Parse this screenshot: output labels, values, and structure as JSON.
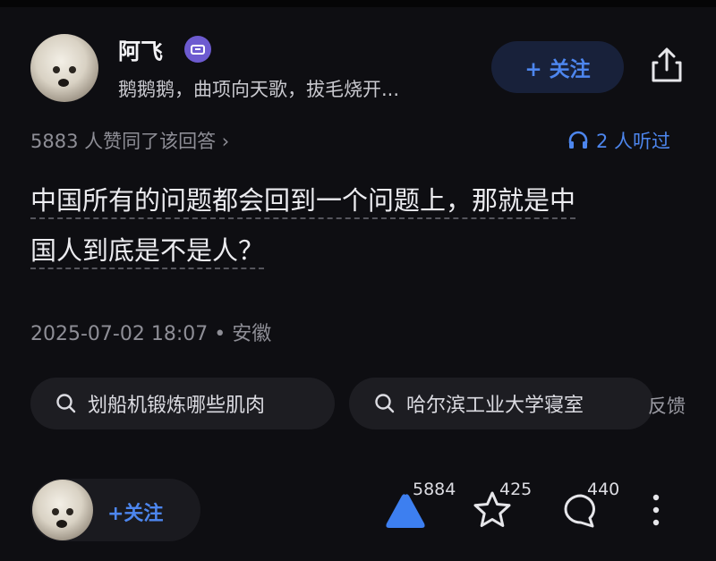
{
  "author": {
    "name": "阿飞",
    "bio": "鹅鹅鹅，曲项向天歌，拔毛烧开...",
    "follow_label": "+ 关注"
  },
  "stats": {
    "agree_text": "5883 人赞同了该回答 ›",
    "listen_text": "2 人听过"
  },
  "answer": {
    "line1": "中国所有的问题都会回到一个问题上，那就是中",
    "line2": "国人到底是不是人？"
  },
  "meta": {
    "timestamp_location": "2025-07-02 18:07 • 安徽"
  },
  "search_chips": [
    {
      "label": "划船机锻炼哪些肌肉"
    },
    {
      "label": "哈尔滨工业大学寝室"
    }
  ],
  "feedback_label": "反馈",
  "bottom_bar": {
    "follow_label": "+关注",
    "upvote_count": "5884",
    "favorite_count": "425",
    "comment_count": "440"
  },
  "colors": {
    "background": "#0e0e12",
    "accent_blue": "#4d86ee",
    "badge_purple": "#6d5bd0"
  },
  "icons": [
    "verified-badge-icon",
    "share-icon",
    "headphones-icon",
    "search-icon",
    "upvote-triangle-icon",
    "star-icon",
    "comment-icon",
    "more-vertical-icon"
  ]
}
